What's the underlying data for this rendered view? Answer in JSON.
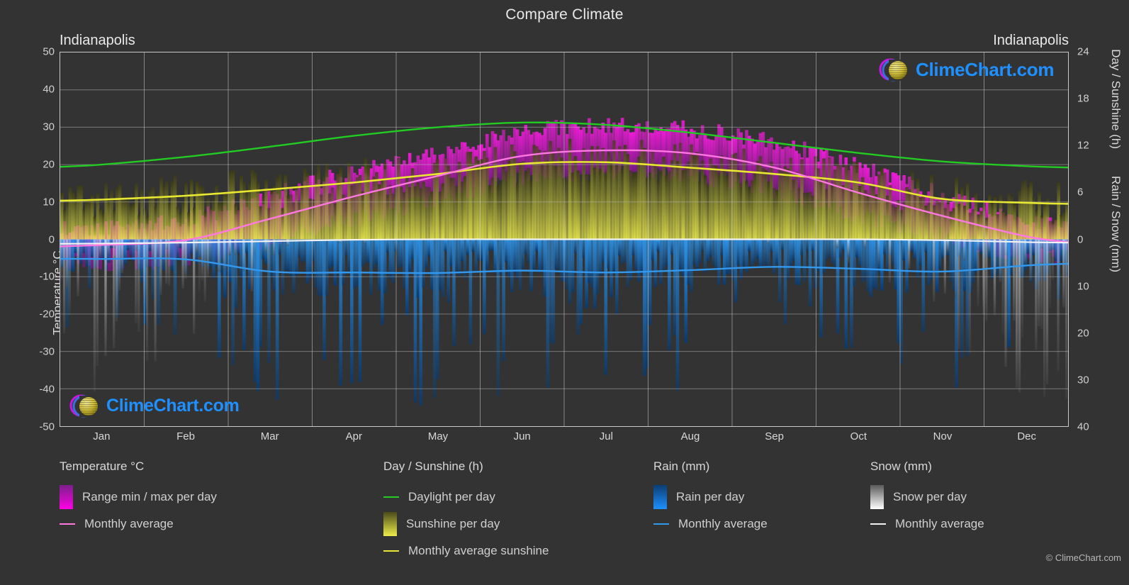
{
  "header": {
    "title": "Compare Climate",
    "city_left": "Indianapolis",
    "city_right": "Indianapolis"
  },
  "watermark": {
    "text": "ClimeChart.com",
    "ring_color": "#c71ae0",
    "ring_color2": "#2e7de0",
    "sphere_color": "#d9c93a",
    "text_color": "#1e90ff"
  },
  "axes": {
    "left": {
      "label": "Temperature °C",
      "ticks": [
        50,
        40,
        30,
        20,
        10,
        0,
        -10,
        -20,
        -30,
        -40,
        -50
      ],
      "min": -50,
      "max": 50
    },
    "right_top": {
      "label": "Day / Sunshine (h)",
      "ticks": [
        24,
        18,
        12,
        6,
        0
      ],
      "min": 0,
      "max": 24
    },
    "right_bottom": {
      "label": "Rain / Snow (mm)",
      "ticks": [
        0,
        10,
        20,
        30,
        40
      ],
      "min": 0,
      "max": 40
    },
    "x": {
      "ticks": [
        "Jan",
        "Feb",
        "Mar",
        "Apr",
        "May",
        "Jun",
        "Jul",
        "Aug",
        "Sep",
        "Oct",
        "Nov",
        "Dec"
      ]
    }
  },
  "legend": {
    "groups": [
      {
        "title": "Temperature °C",
        "items": [
          {
            "label": "Range min / max per day",
            "marker": "gradient-box",
            "color": "#ff00e6",
            "color2": "#7b1f8a"
          },
          {
            "label": "Monthly average",
            "marker": "line",
            "color": "#ff77e0"
          }
        ]
      },
      {
        "title": "Day / Sunshine (h)",
        "items": [
          {
            "label": "Daylight per day",
            "marker": "line",
            "color": "#22cc22"
          },
          {
            "label": "Sunshine per day",
            "marker": "gradient-box",
            "color": "#eded4a",
            "color2": "#4a4a1a"
          },
          {
            "label": "Monthly average sunshine",
            "marker": "line",
            "color": "#e8e832"
          }
        ]
      },
      {
        "title": "Rain (mm)",
        "items": [
          {
            "label": "Rain per day",
            "marker": "gradient-box",
            "color": "#1e90ff",
            "color2": "#0b3d73"
          },
          {
            "label": "Monthly average",
            "marker": "line",
            "color": "#3399ee"
          }
        ]
      },
      {
        "title": "Snow (mm)",
        "items": [
          {
            "label": "Snow per day",
            "marker": "gradient-box",
            "color": "#ffffff",
            "color2": "#5a5a5a"
          },
          {
            "label": "Monthly average",
            "marker": "line",
            "color": "#f2f2f2"
          }
        ]
      }
    ],
    "copyright": "© ClimeChart.com"
  },
  "chart_data": {
    "type": "line",
    "title": "Compare Climate",
    "location": "Indianapolis",
    "xlabel": "",
    "ylabel": "Temperature °C",
    "ylim": [
      -50,
      50
    ],
    "y2_top_lim": [
      0,
      24
    ],
    "y2_bottom_lim": [
      0,
      40
    ],
    "grid": true,
    "legend_position": "below",
    "categories": [
      "Jan",
      "Feb",
      "Mar",
      "Apr",
      "May",
      "Jun",
      "Jul",
      "Aug",
      "Sep",
      "Oct",
      "Nov",
      "Dec"
    ],
    "series": [
      {
        "name": "Daylight per day",
        "unit": "h",
        "axis": "right_top",
        "color": "#22cc22",
        "values": [
          9.6,
          10.6,
          11.9,
          13.3,
          14.4,
          15.0,
          14.7,
          13.7,
          12.4,
          11.1,
          10.0,
          9.4
        ]
      },
      {
        "name": "Monthly average sunshine",
        "unit": "h",
        "axis": "right_top",
        "color": "#e8e832",
        "values": [
          5.1,
          5.6,
          6.4,
          7.3,
          8.4,
          9.7,
          9.9,
          9.2,
          8.4,
          7.3,
          5.2,
          4.7
        ]
      },
      {
        "name": "Monthly average temperature",
        "unit": "°C",
        "axis": "left",
        "color": "#ff77e0",
        "values": [
          -1.5,
          -0.2,
          5.5,
          11.5,
          17.0,
          22.3,
          23.8,
          23.0,
          19.2,
          12.5,
          6.3,
          0.8
        ]
      },
      {
        "name": "Rain monthly average",
        "unit": "mm",
        "axis": "right_bottom",
        "color": "#3399ee",
        "values": [
          4.2,
          4.3,
          6.9,
          7.1,
          7.2,
          6.7,
          7.1,
          6.6,
          5.9,
          6.3,
          6.9,
          5.6
        ]
      },
      {
        "name": "Snow monthly average",
        "unit": "mm",
        "axis": "right_bottom",
        "color": "#f2f2f2",
        "values": [
          0.9,
          0.7,
          0.4,
          0.1,
          0.0,
          0.0,
          0.0,
          0.0,
          0.0,
          0.0,
          0.2,
          0.6
        ]
      },
      {
        "name": "Temperature range max per day",
        "unit": "°C",
        "axis": "left",
        "color": "#ff00e6",
        "values": [
          3.0,
          5.0,
          11.5,
          18.0,
          23.0,
          28.5,
          30.0,
          29.0,
          25.5,
          19.0,
          11.5,
          5.0
        ]
      },
      {
        "name": "Temperature range min per day",
        "unit": "°C",
        "axis": "left",
        "color": "#ff00e6",
        "values": [
          -6.5,
          -5.0,
          0.0,
          5.5,
          11.0,
          16.5,
          18.0,
          17.0,
          13.0,
          6.5,
          1.0,
          -4.0
        ]
      }
    ]
  }
}
